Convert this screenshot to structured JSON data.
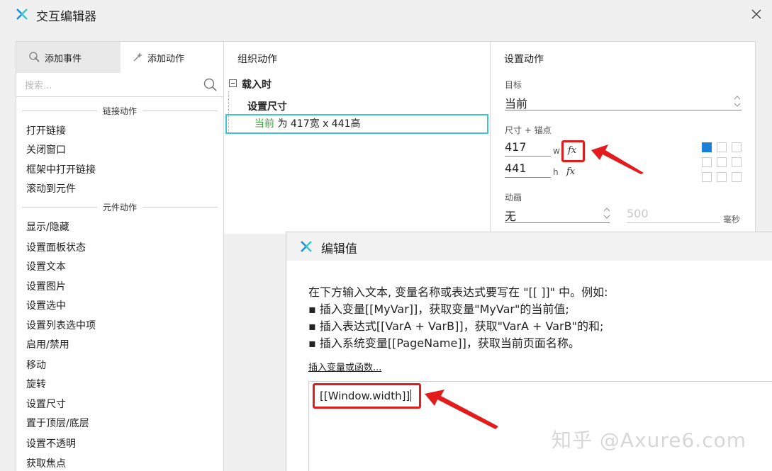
{
  "window": {
    "title": "交互编辑器",
    "logo_icon": "axure-x-logo",
    "close_icon": "close-icon"
  },
  "left_panel": {
    "tabs": [
      {
        "label": "添加事件",
        "icon": "event-icon"
      },
      {
        "label": "添加动作",
        "icon": "sparkle-icon"
      }
    ],
    "search_placeholder": "搜索...",
    "groups": [
      {
        "label": "链接动作",
        "items": [
          "打开链接",
          "关闭窗口",
          "框架中打开链接",
          "滚动到元件"
        ]
      },
      {
        "label": "元件动作",
        "items": [
          "显示/隐藏",
          "设置面板状态",
          "设置文本",
          "设置图片",
          "设置选中",
          "设置列表选中项",
          "启用/禁用",
          "移动",
          "旋转",
          "设置尺寸",
          "置于顶层/底层",
          "设置不透明",
          "获取焦点"
        ]
      }
    ]
  },
  "middle_panel": {
    "title": "组织动作",
    "event": "载入时",
    "case": "设置尺寸",
    "action": {
      "target": "当前",
      "rest": " 为 417宽 x 441高"
    }
  },
  "right_panel": {
    "title": "设置动作",
    "target_label": "目标",
    "target_value": "当前",
    "size_label": "尺寸 + 锚点",
    "width_value": "417",
    "width_unit": "w",
    "height_value": "441",
    "height_unit": "h",
    "fx_label": "fx",
    "anim_label": "动画",
    "anim_value": "无",
    "duration_placeholder": "500",
    "duration_unit": "毫秒",
    "anchor_selected": "top-left",
    "colors": {
      "anchor_selected": "#1a7fd6",
      "highlight": "#e21c1c",
      "case_border": "#3fc6d6"
    }
  },
  "dialog": {
    "title": "编辑值",
    "instructions": [
      "在下方输入文本, 变量名称或表达式要写在 \"[[ ]]\" 中。例如:",
      "▪ 插入变量[[MyVar]]，获取变量\"MyVar\"的当前值;",
      "▪ 插入表达式[[VarA + VarB]]，获取\"VarA + VarB\"的和;",
      "▪ 插入系统变量[[PageName]]，获取当前页面名称。"
    ],
    "insert_link": "插入变量或函数...",
    "editor_value": "[[Window.width]]"
  },
  "watermark": "知乎 @Axure6.com"
}
